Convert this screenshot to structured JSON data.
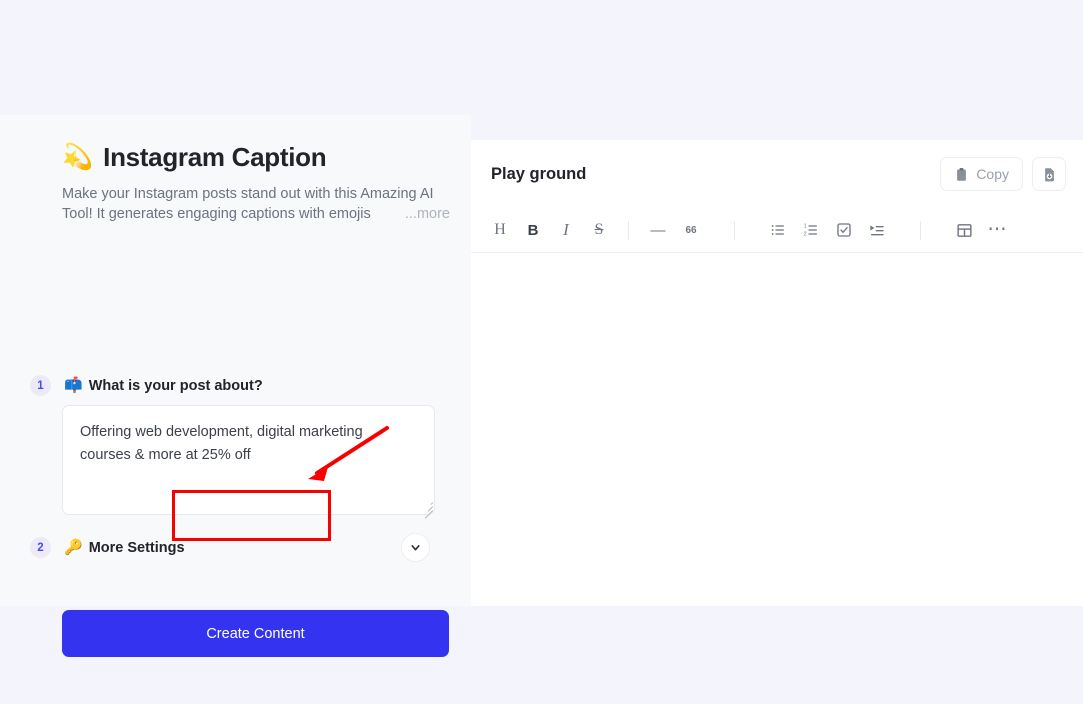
{
  "page": {
    "background_color": "#f4f4fc",
    "card_background": "#f8f9fa",
    "accent_color": "#3333f0",
    "annotation_color": "#f90000"
  },
  "app": {
    "emoji": "star-burst-emoji",
    "emoji_glyph": "💫",
    "title": "Instagram Caption",
    "description": "Make your Instagram posts stand out with this Amazing AI Tool! It generates engaging captions with emojis",
    "more_label": "...more"
  },
  "form": {
    "steps": [
      {
        "number": "1",
        "icon_name": "mailbox-emoji",
        "icon_glyph": "📫",
        "label": "What is your post about?"
      },
      {
        "number": "2",
        "icon_name": "key-emoji",
        "icon_glyph": "🔑",
        "label": "More Settings"
      }
    ],
    "post_input": {
      "value": "Offering web development, digital marketing courses & more at 25% off",
      "placeholder": "What is your post about?"
    },
    "submit_label": "Create Content"
  },
  "playground": {
    "title": "Play ground",
    "copy_label": "Copy",
    "copy_icon": "clipboard-icon",
    "save_icon": "file-download-icon",
    "editor_content": "",
    "toolbar": [
      {
        "name": "heading",
        "glyph": "H"
      },
      {
        "name": "bold",
        "glyph": "B"
      },
      {
        "name": "italic",
        "glyph": "I"
      },
      {
        "name": "strikethrough",
        "glyph": "S"
      },
      {
        "name": "separator",
        "glyph": ""
      },
      {
        "name": "horizontal-rule",
        "glyph": "—"
      },
      {
        "name": "blockquote",
        "glyph": "66"
      },
      {
        "name": "separator",
        "glyph": ""
      },
      {
        "name": "bulleted-list",
        "glyph": ""
      },
      {
        "name": "numbered-list",
        "glyph": ""
      },
      {
        "name": "checklist",
        "glyph": ""
      },
      {
        "name": "collapsible-list",
        "glyph": ""
      },
      {
        "name": "separator",
        "glyph": ""
      },
      {
        "name": "table",
        "glyph": ""
      },
      {
        "name": "more-options",
        "glyph": "⋯"
      }
    ]
  }
}
